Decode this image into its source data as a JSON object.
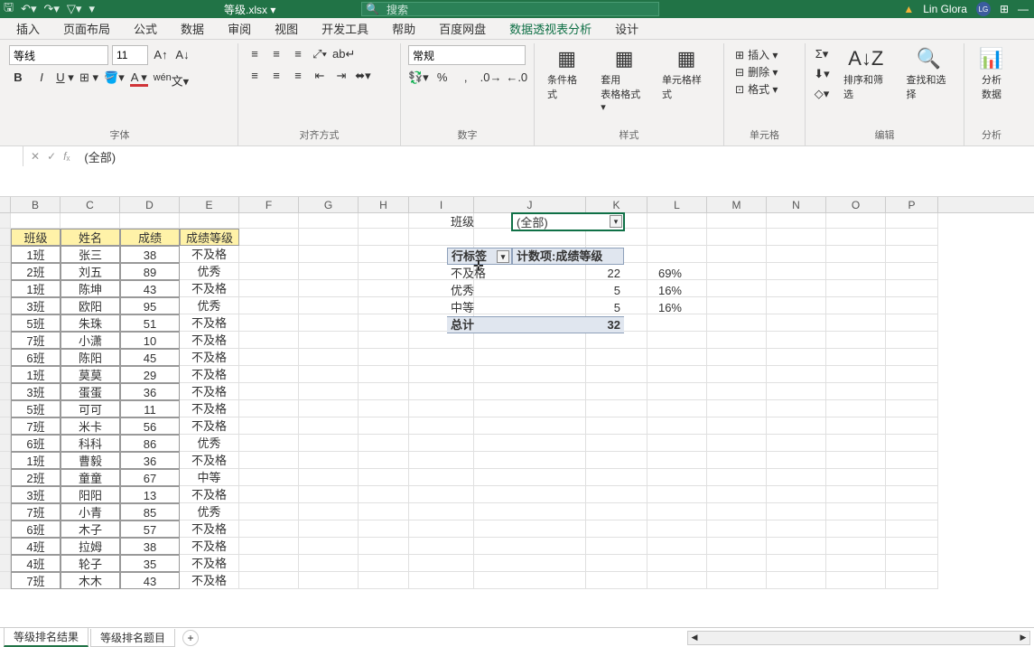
{
  "titlebar": {
    "filename": "等级.xlsx ▾",
    "search_placeholder": "搜索",
    "user": "Lin Glora",
    "user_initials": "LG"
  },
  "tabs": [
    "插入",
    "页面布局",
    "公式",
    "数据",
    "审阅",
    "视图",
    "开发工具",
    "帮助",
    "百度网盘",
    "数据透视表分析",
    "设计"
  ],
  "active_tab": 9,
  "ribbon": {
    "font": {
      "name": "等线",
      "size": "11",
      "group": "字体"
    },
    "align": {
      "group": "对齐方式"
    },
    "number": {
      "fmt": "常规",
      "group": "数字"
    },
    "styles": {
      "cond": "条件格式",
      "tablefmt": "套用\n表格格式 ▾",
      "cellfmt": "单元格样式",
      "group": "样式"
    },
    "cells": {
      "insert": "插入 ▾",
      "delete": "删除 ▾",
      "format": "格式 ▾",
      "group": "单元格"
    },
    "edit": {
      "sort": "排序和筛选",
      "find": "查找和选择",
      "group": "编辑"
    },
    "analyze": {
      "label": "分析\n数据",
      "group": "分析"
    }
  },
  "formula_value": "(全部)",
  "columns": [
    "B",
    "C",
    "D",
    "E",
    "F",
    "G",
    "H",
    "I",
    "J",
    "K",
    "L",
    "M",
    "N",
    "O",
    "P"
  ],
  "table_headers": [
    "班级",
    "姓名",
    "成绩",
    "成绩等级"
  ],
  "table_rows": [
    [
      "1班",
      "张三",
      "38",
      "不及格"
    ],
    [
      "2班",
      "刘五",
      "89",
      "优秀"
    ],
    [
      "1班",
      "陈坤",
      "43",
      "不及格"
    ],
    [
      "3班",
      "欧阳",
      "95",
      "优秀"
    ],
    [
      "5班",
      "朱珠",
      "51",
      "不及格"
    ],
    [
      "7班",
      "小潇",
      "10",
      "不及格"
    ],
    [
      "6班",
      "陈阳",
      "45",
      "不及格"
    ],
    [
      "1班",
      "莫莫",
      "29",
      "不及格"
    ],
    [
      "3班",
      "蛋蛋",
      "36",
      "不及格"
    ],
    [
      "5班",
      "可可",
      "11",
      "不及格"
    ],
    [
      "7班",
      "米卡",
      "56",
      "不及格"
    ],
    [
      "6班",
      "科科",
      "86",
      "优秀"
    ],
    [
      "1班",
      "曹毅",
      "36",
      "不及格"
    ],
    [
      "2班",
      "童童",
      "67",
      "中等"
    ],
    [
      "3班",
      "阳阳",
      "13",
      "不及格"
    ],
    [
      "7班",
      "小青",
      "85",
      "优秀"
    ],
    [
      "6班",
      "木子",
      "57",
      "不及格"
    ],
    [
      "4班",
      "拉姆",
      "38",
      "不及格"
    ],
    [
      "4班",
      "轮子",
      "35",
      "不及格"
    ],
    [
      "7班",
      "木木",
      "43",
      "不及格"
    ]
  ],
  "pivot": {
    "filter_label": "班级",
    "filter_value": "(全部)",
    "row_label": "行标签",
    "col_label": "计数项:成绩等级",
    "rows": [
      [
        "不及格",
        "22",
        "69%"
      ],
      [
        "优秀",
        "5",
        "16%"
      ],
      [
        "中等",
        "5",
        "16%"
      ]
    ],
    "total_label": "总计",
    "total_value": "32"
  },
  "sheets": [
    "等级排名结果",
    "等级排名题目"
  ],
  "active_sheet": 0
}
